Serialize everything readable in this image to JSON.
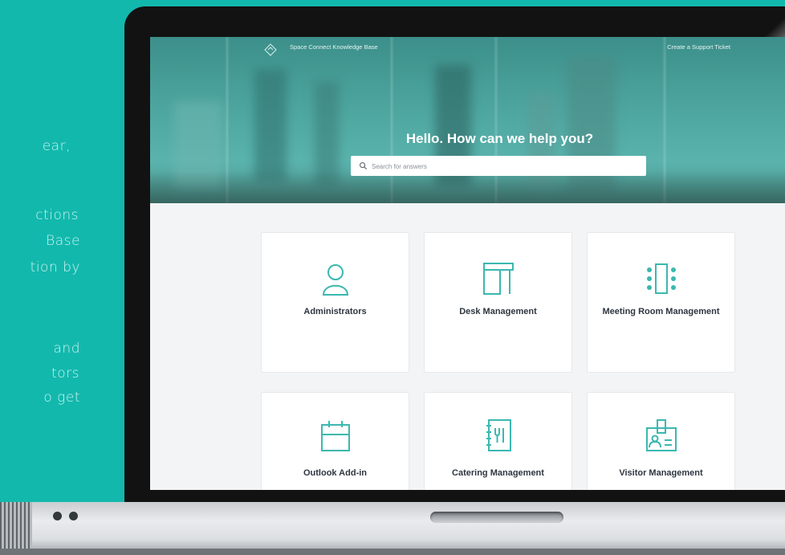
{
  "side_text": {
    "lines": [
      "ear,",
      "ctions",
      "Base",
      "tion by",
      "and",
      "tors",
      "o get"
    ]
  },
  "topbar": {
    "title": "Space Connect Knowledge Base",
    "support_link": "Create a Support Ticket"
  },
  "hero": {
    "heading": "Hello. How can we help you?"
  },
  "search": {
    "placeholder": "Search for answers"
  },
  "cards": [
    {
      "label": "Administrators",
      "icon": "user-icon"
    },
    {
      "label": "Desk Management",
      "icon": "desk-icon"
    },
    {
      "label": "Meeting Room Management",
      "icon": "meeting-room-icon"
    },
    {
      "label": "Outlook Add-in",
      "icon": "calendar-icon"
    },
    {
      "label": "Catering Management",
      "icon": "catering-menu-icon"
    },
    {
      "label": "Visitor Management",
      "icon": "visitor-badge-icon"
    }
  ],
  "colors": {
    "background": "#13b8ad",
    "accent": "#3bb8b0",
    "text_dark": "#2e3640"
  }
}
